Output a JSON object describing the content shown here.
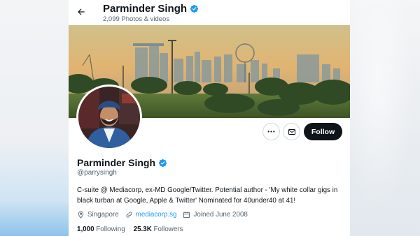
{
  "header": {
    "title": "Parminder Singh",
    "subtitle": "2,099 Photos & videos",
    "back_icon": "arrow-left-icon"
  },
  "profile": {
    "name": "Parminder Singh",
    "handle": "@parrysingh",
    "verified": true,
    "bio": "C-suite @ Mediacorp, ex-MD Google/Twitter. Potential author - 'My white collar gigs in black turban at Google, Apple & Twitter' Nominated for 40under40 at 41!",
    "location": "Singapore",
    "website": "mediacorp.sg",
    "joined": "Joined June 2008",
    "following_count": "1,000",
    "following_label": "Following",
    "followers_count": "25.3K",
    "followers_label": "Followers"
  },
  "actions": {
    "more_icon": "more-horizontal-icon",
    "message_icon": "envelope-icon",
    "follow_label": "Follow"
  },
  "colors": {
    "accent": "#1d9bf0",
    "text_primary": "#0f1419",
    "text_secondary": "#536471",
    "follow_bg": "#0f1419"
  }
}
